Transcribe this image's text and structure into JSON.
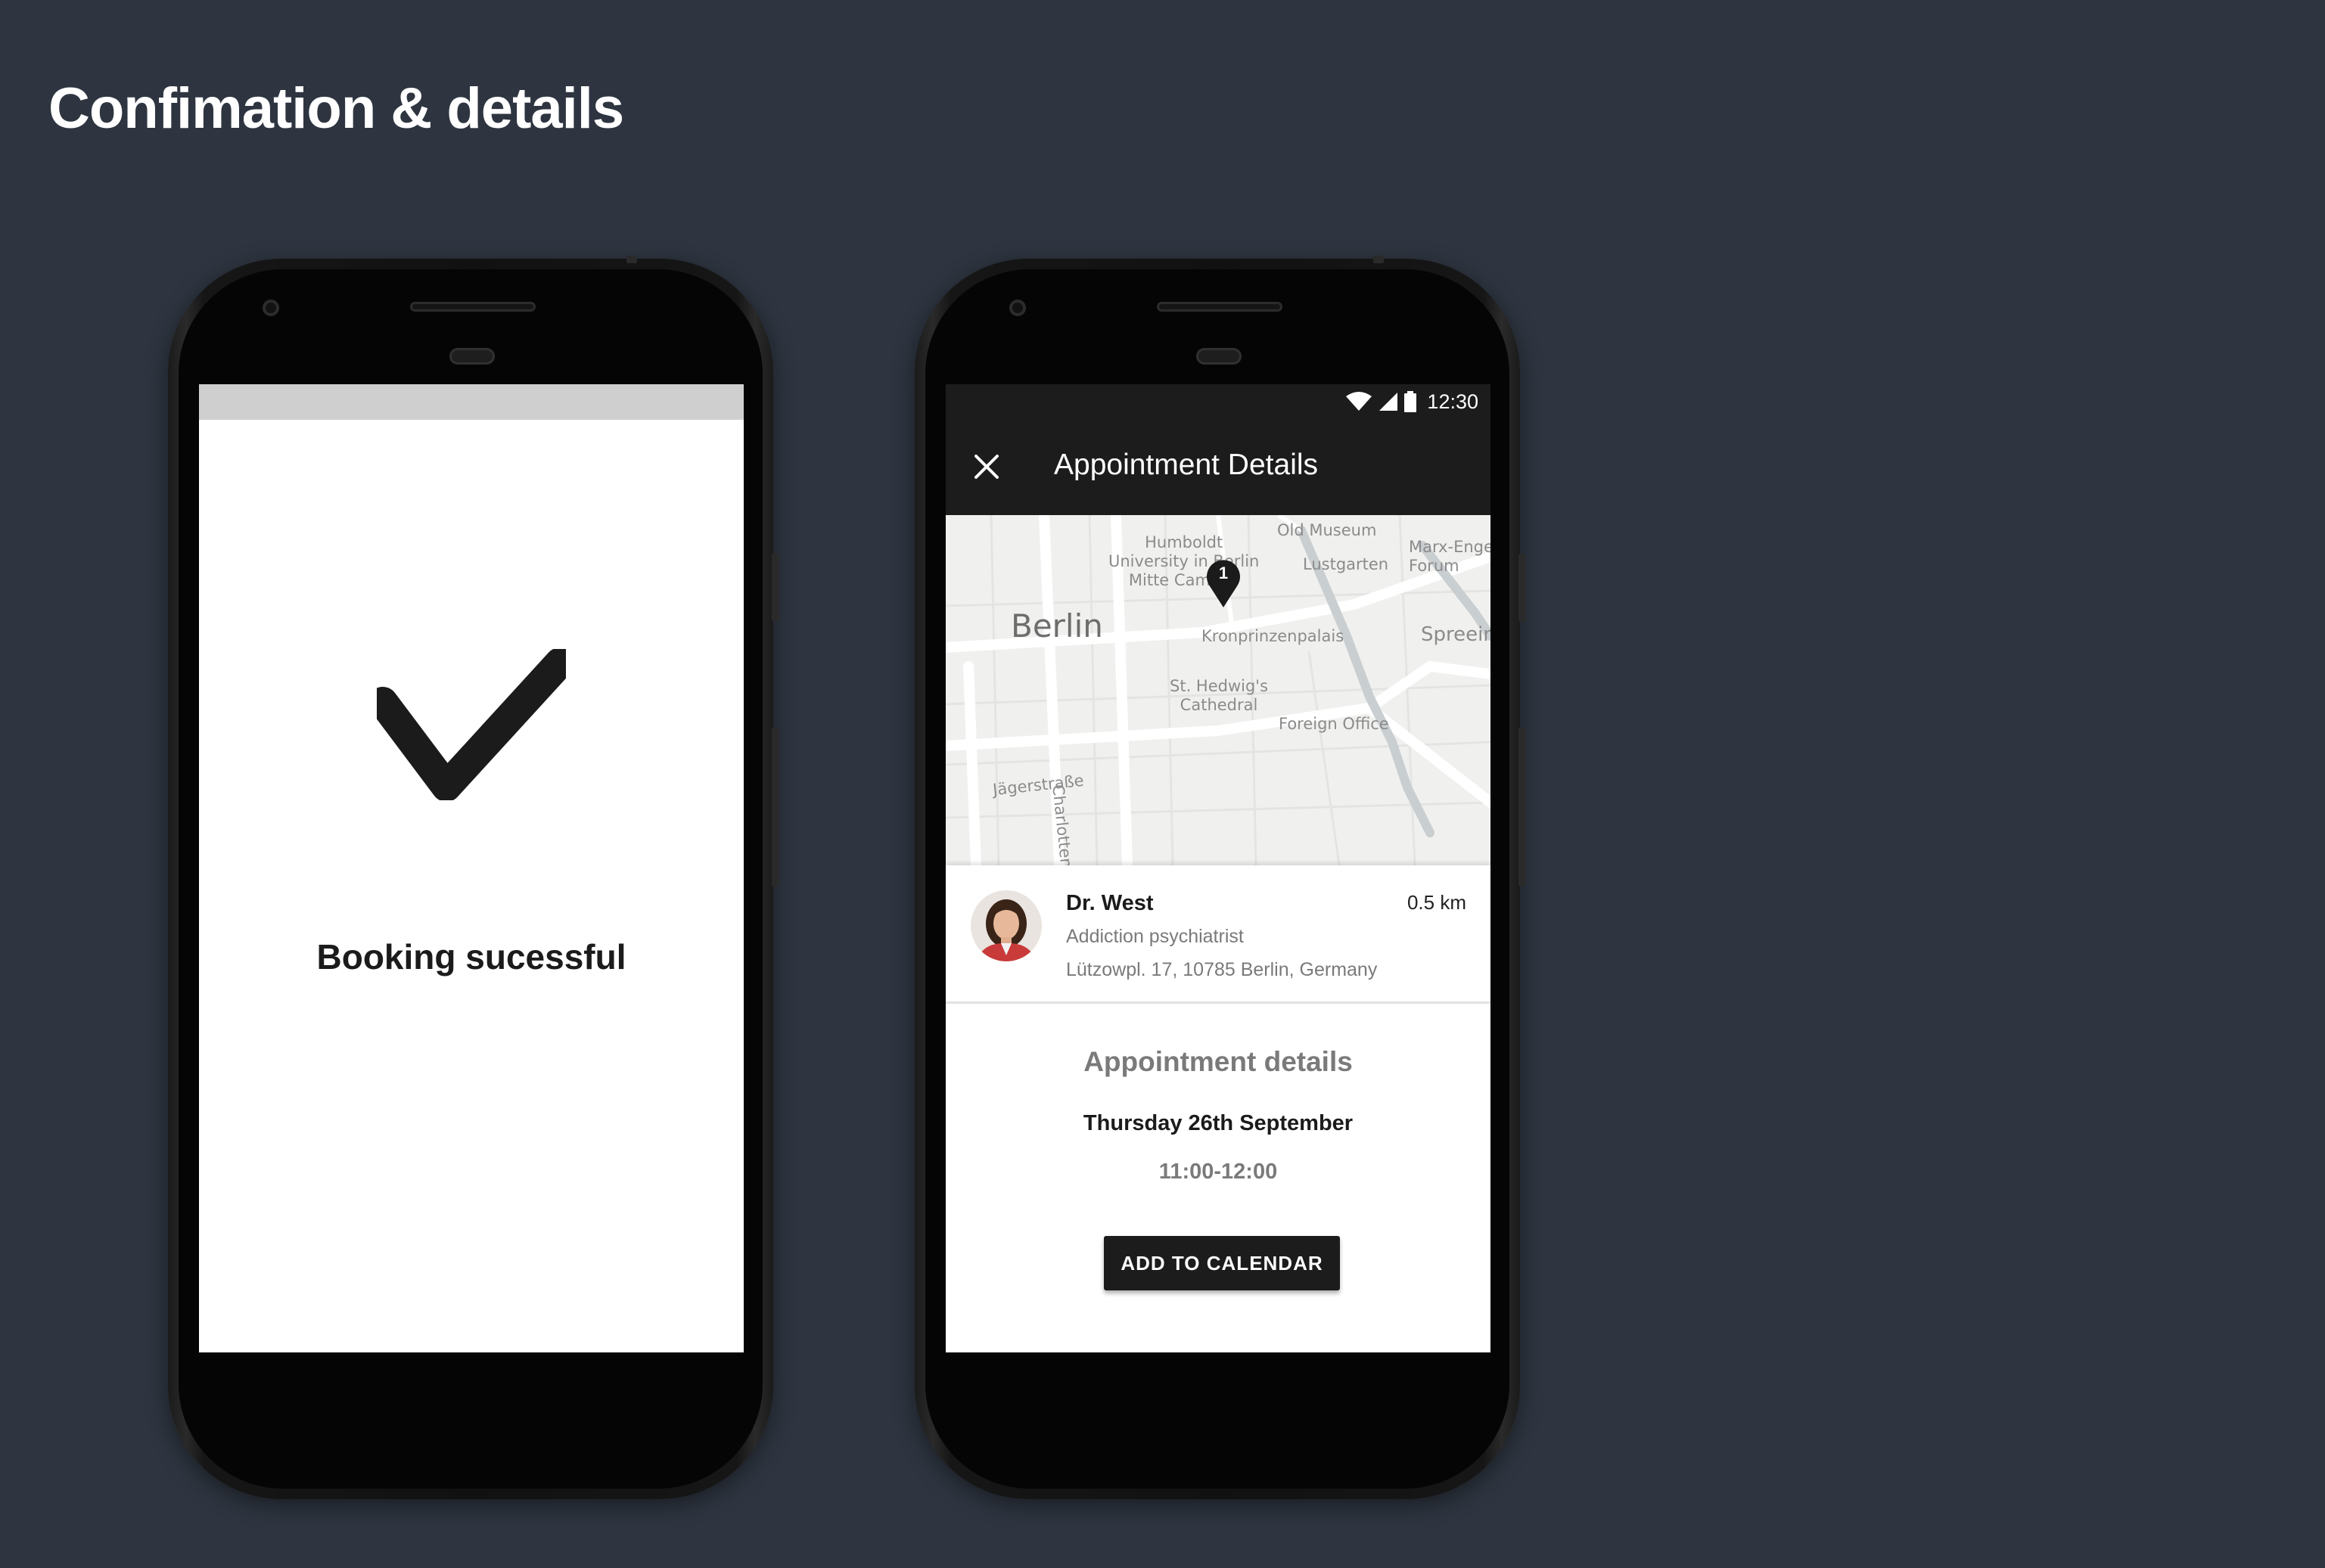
{
  "page": {
    "title": "Confimation & details"
  },
  "confirmation_screen": {
    "message": "Booking sucessful",
    "icon": "checkmark-icon"
  },
  "details_screen": {
    "status_bar": {
      "time": "12:30",
      "icons": [
        "wifi-icon",
        "signal-icon",
        "battery-icon"
      ]
    },
    "app_bar": {
      "title": "Appointment Details",
      "close_icon": "close-icon"
    },
    "map": {
      "city_label": "Berlin",
      "marker_number": "1",
      "labels": {
        "humboldt": "Humboldt\nUniversity in Berlin\nMitte Campus",
        "old_museum": "Old Museum",
        "lustgarten": "Lustgarten",
        "marx_engels": "Marx-Engels\nForum",
        "kronprinzenpalais": "Kronprinzenpalais",
        "spreeinsel": "Spreeinsel",
        "st_hedwig": "St. Hedwig's\nCathedral",
        "foreign_office": "Foreign Office",
        "jaegerstrasse": "Jägerstraße",
        "charlottenstrasse": "Charlottenstraße"
      }
    },
    "doctor": {
      "name": "Dr. West",
      "distance": "0.5 km",
      "specialty": "Addiction psychiatrist",
      "address": "Lützowpl. 17, 10785 Berlin, Germany"
    },
    "appointment": {
      "heading": "Appointment details",
      "date": "Thursday 26th September",
      "time": "11:00-12:00",
      "button_label": "ADD TO CALENDAR"
    }
  },
  "colors": {
    "background": "#2e3540",
    "app_bar": "#1c1c1c",
    "accent_dark": "#1b1b1b",
    "muted_text": "#7a7a7a"
  }
}
